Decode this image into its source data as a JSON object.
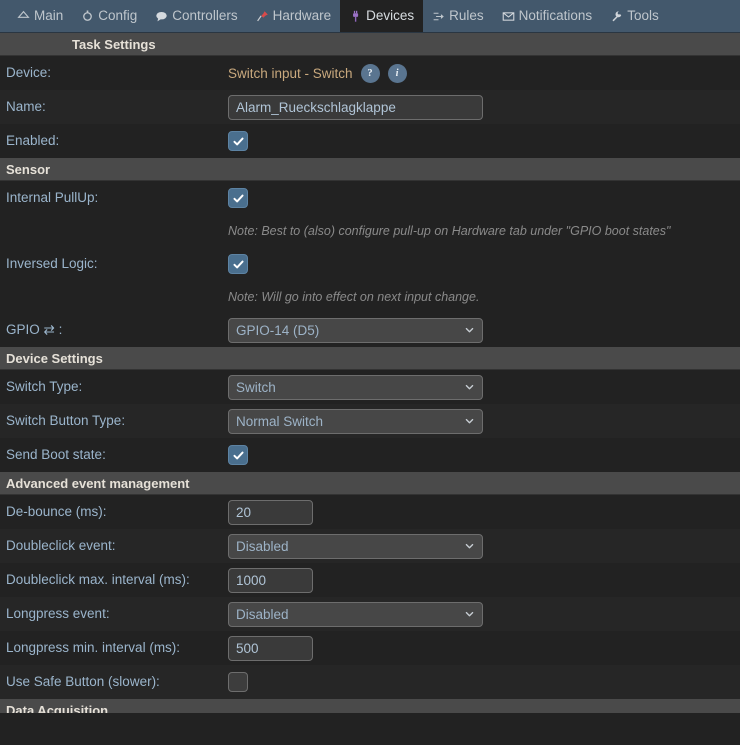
{
  "nav": {
    "items": [
      {
        "label": "Main",
        "icon": "home-icon",
        "active": false
      },
      {
        "label": "Config",
        "icon": "gear-icon",
        "active": false
      },
      {
        "label": "Controllers",
        "icon": "speech-bubble-icon",
        "active": false
      },
      {
        "label": "Hardware",
        "icon": "pushpin-icon",
        "active": false
      },
      {
        "label": "Devices",
        "icon": "plug-icon",
        "active": true
      },
      {
        "label": "Rules",
        "icon": "branch-arrow-icon",
        "active": false
      },
      {
        "label": "Notifications",
        "icon": "envelope-icon",
        "active": false
      },
      {
        "label": "Tools",
        "icon": "wrench-icon",
        "active": false
      }
    ],
    "colors": {
      "bar": "#43586c",
      "active_bg": "#222222",
      "text": "#bfc6cc"
    }
  },
  "sections": {
    "task_settings": "Task Settings",
    "sensor": "Sensor",
    "device_settings": "Device Settings",
    "advanced": "Advanced event management",
    "data_acquisition": "Data Acquisition"
  },
  "task_settings": {
    "device_label": "Device:",
    "device_value": "Switch input - Switch",
    "help_button": "?",
    "info_button": "i",
    "name_label": "Name:",
    "name_value": "Alarm_Rueckschlagklappe",
    "enabled_label": "Enabled:",
    "enabled_checked": true
  },
  "sensor": {
    "pullup_label": "Internal PullUp:",
    "pullup_checked": true,
    "pullup_note": "Note: Best to (also) configure pull-up on Hardware tab under \"GPIO boot states\"",
    "inversed_label": "Inversed Logic:",
    "inversed_checked": true,
    "inversed_note": "Note: Will go into effect on next input change.",
    "gpio_label": "GPIO ⇄ :",
    "gpio_value": "GPIO-14 (D5)",
    "gpio_options": [
      "GPIO-14 (D5)"
    ]
  },
  "device_settings": {
    "switch_type_label": "Switch Type:",
    "switch_type_value": "Switch",
    "switch_type_options": [
      "Switch"
    ],
    "switch_button_type_label": "Switch Button Type:",
    "switch_button_type_value": "Normal Switch",
    "switch_button_type_options": [
      "Normal Switch"
    ],
    "send_boot_state_label": "Send Boot state:",
    "send_boot_state_checked": true
  },
  "advanced": {
    "debounce_label": "De-bounce (ms):",
    "debounce_value": "20",
    "doubleclick_event_label": "Doubleclick event:",
    "doubleclick_event_value": "Disabled",
    "doubleclick_event_options": [
      "Disabled"
    ],
    "doubleclick_interval_label": "Doubleclick max. interval (ms):",
    "doubleclick_interval_value": "1000",
    "longpress_event_label": "Longpress event:",
    "longpress_event_value": "Disabled",
    "longpress_event_options": [
      "Disabled"
    ],
    "longpress_interval_label": "Longpress min. interval (ms):",
    "longpress_interval_value": "500",
    "safe_button_label": "Use Safe Button (slower):",
    "safe_button_checked": false
  },
  "colors": {
    "page_bg": "#222222",
    "row_alt_bg": "#262626",
    "section_header_bg": "#4a4a4a",
    "label_text": "#9bb5cc",
    "value_text": "#c9a97e",
    "accent_checkbox": "#4a6f8e",
    "note_text": "#8a8a8a"
  }
}
